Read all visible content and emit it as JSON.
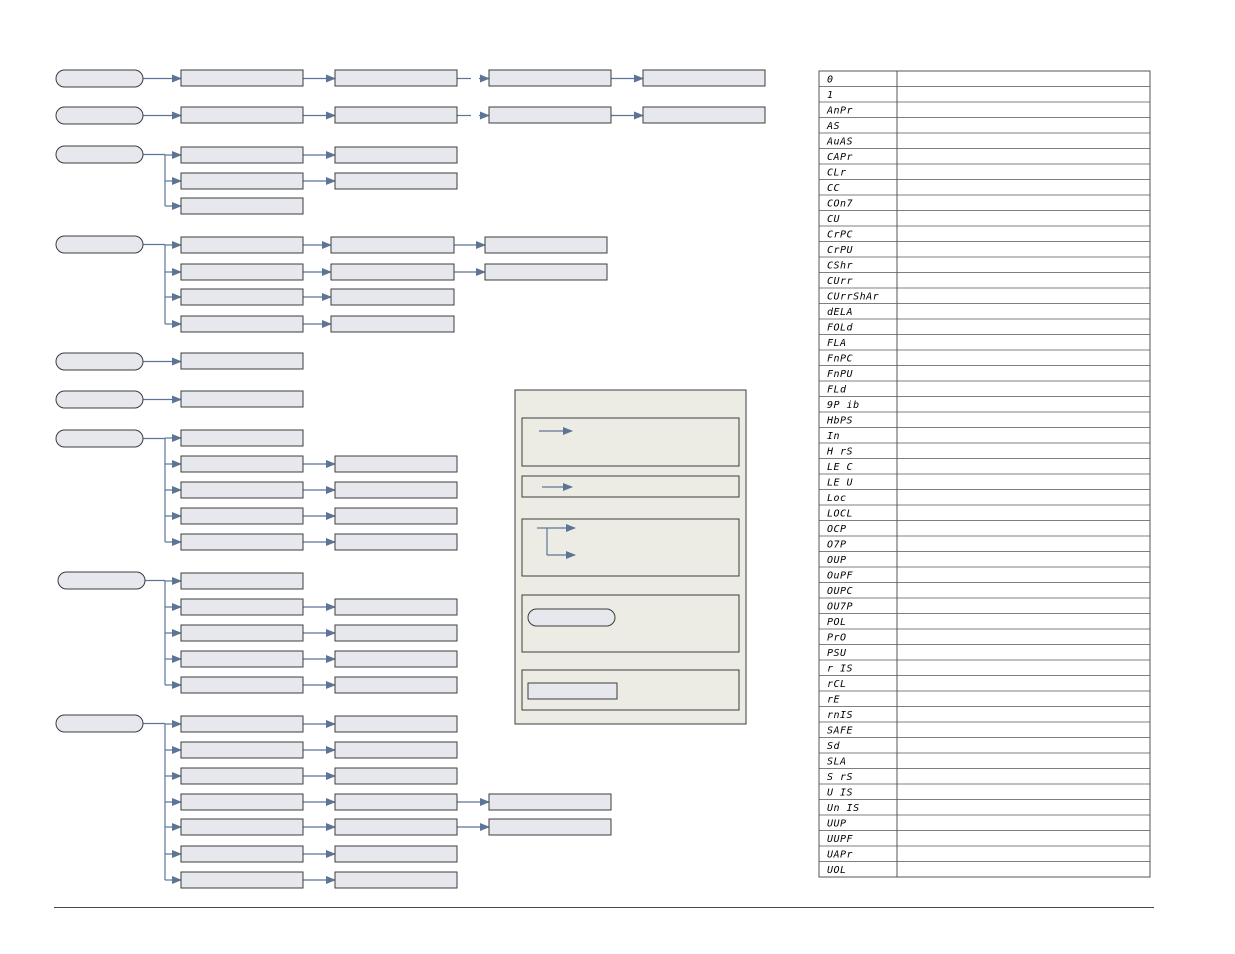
{
  "colors": {
    "box_fill": "#e6e8ed",
    "box_stroke": "#3c3c3c",
    "connector": "#5c7597",
    "legend_bg": "#ecece4",
    "table_stroke": "#555555"
  },
  "codes": [
    "0",
    "1",
    "AnPr",
    "AS",
    "AuAS",
    "CAPr",
    "CLr",
    "CC",
    "COn7",
    "CU",
    "CrPC",
    "CrPU",
    "CShr",
    "CUrr",
    "CUrrShAr",
    "dELA",
    "FOLd",
    "FLA",
    "FnPC",
    "FnPU",
    "FLd",
    "9P ib",
    "HbPS",
    "In",
    "H rS",
    "LE C",
    "LE U",
    "Loc",
    "LOCL",
    "OCP",
    "O7P",
    "OUP",
    "OuPF",
    "OUPC",
    "OU7P",
    "POL",
    "PrO",
    "PSU",
    "r IS",
    "rCL",
    "rE",
    "rnIS",
    "SAFE",
    "Sd",
    "SLA",
    "S rS",
    "U IS",
    "Un IS",
    "UUP",
    "UUPF",
    "UAPr",
    "UOL"
  ]
}
